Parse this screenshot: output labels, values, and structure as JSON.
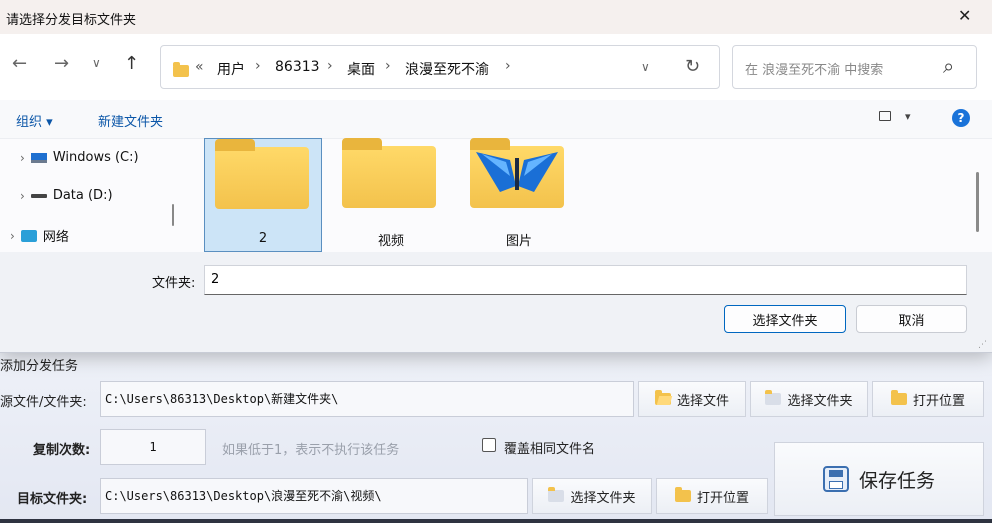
{
  "dialog": {
    "title": "请选择分发目标文件夹",
    "close_glyph": "✕",
    "nav": {
      "back": "←",
      "forward": "→",
      "recent": "∨",
      "up": "↑"
    },
    "breadcrumb": {
      "overflow": "«",
      "items": [
        "用户",
        "86313",
        "桌面",
        "浪漫至死不渝"
      ],
      "sep": "›"
    },
    "address_dropdown": "∨",
    "refresh": "↻",
    "search_placeholder": "在 浪漫至死不渝 中搜索",
    "search_glyph": "⌕",
    "toolbar": {
      "organize": "组织 ▾",
      "new_folder": "新建文件夹",
      "view_glyph": "▾",
      "help": "?"
    },
    "tree": [
      {
        "label": "Windows (C:)",
        "icon": "windows-drive-icon"
      },
      {
        "label": "Data (D:)",
        "icon": "drive-icon"
      },
      {
        "label": "网络",
        "icon": "network-icon"
      }
    ],
    "tiles": [
      {
        "name": "2",
        "selected": true
      },
      {
        "name": "视频",
        "selected": false
      },
      {
        "name": "图片",
        "selected": false
      }
    ],
    "folder_label": "文件夹:",
    "folder_value": "2",
    "select_button": "选择文件夹",
    "cancel_button": "取消"
  },
  "app": {
    "section_title": "添加分发任务",
    "source_label": "源文件/文件夹:",
    "source_value": "C:\\Users\\86313\\Desktop\\新建文件夹\\",
    "select_file": "选择文件",
    "select_folder": "选择文件夹",
    "open_location": "打开位置",
    "copies_label": "复制次数:",
    "copies_value": "1",
    "copies_hint": "如果低于1，表示不执行该任务",
    "overwrite_label": "覆盖相同文件名",
    "target_label": "目标文件夹:",
    "target_value": "C:\\Users\\86313\\Desktop\\浪漫至死不渝\\视频\\",
    "target_select_folder": "选择文件夹",
    "target_open_location": "打开位置",
    "save_task": "保存任务"
  },
  "colors": {
    "accent": "#0067c0",
    "folder": "#f3c24c",
    "selected_tile": "#cce4f7"
  }
}
